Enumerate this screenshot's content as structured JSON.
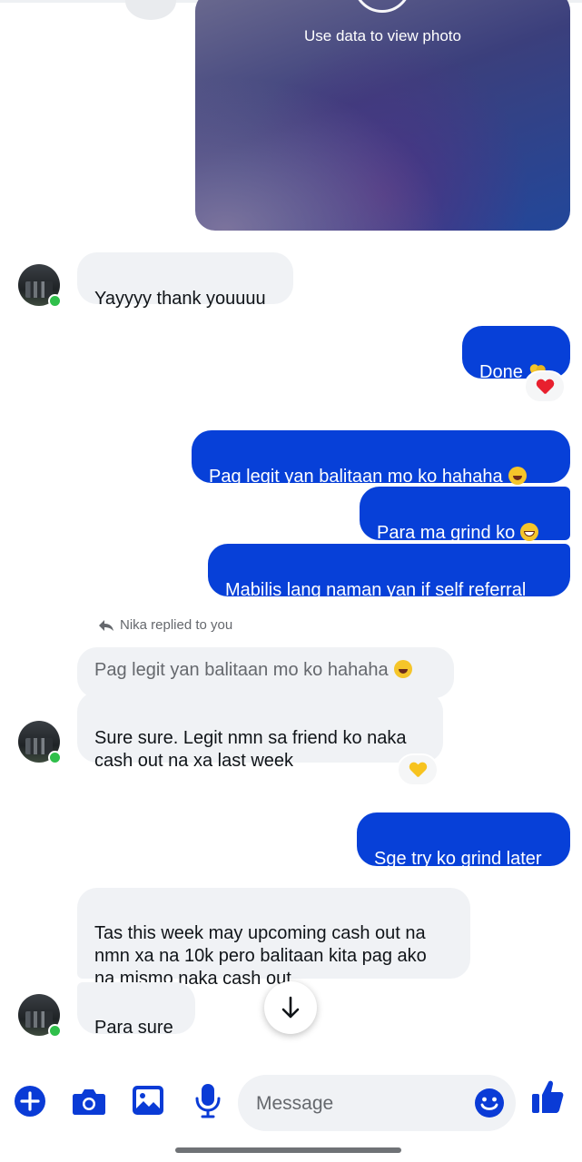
{
  "photo": {
    "notice": "Use data to view photo"
  },
  "messages": {
    "m1": "Yayyyy thank youuuu",
    "m2": "Done",
    "m3": "Pag legit yan balitaan mo ko hahaha",
    "m4": "Para ma grind ko",
    "m5": "Mabilis lang naman yan if self referral",
    "reply_label": "Nika replied to you",
    "quoted": "Pag legit yan balitaan mo ko hahaha",
    "m6": "Sure sure. Legit nmn sa friend ko naka\ncash out na xa last week",
    "m7": "Sge try ko grind later",
    "m8": "Tas this week may upcoming cash out na\nnmn xa na 10k pero balitaan kita pag ako\nna mismo naka cash out",
    "m9": "Para sure"
  },
  "reactions": {
    "done": "red-heart",
    "sure_sure": "yellow-heart"
  },
  "composer": {
    "placeholder": "Message"
  },
  "colors": {
    "outgoing": "#0740d8",
    "incoming": "#f0f2f5",
    "accent": "#0a3bd6",
    "online": "#2fbf4a"
  }
}
